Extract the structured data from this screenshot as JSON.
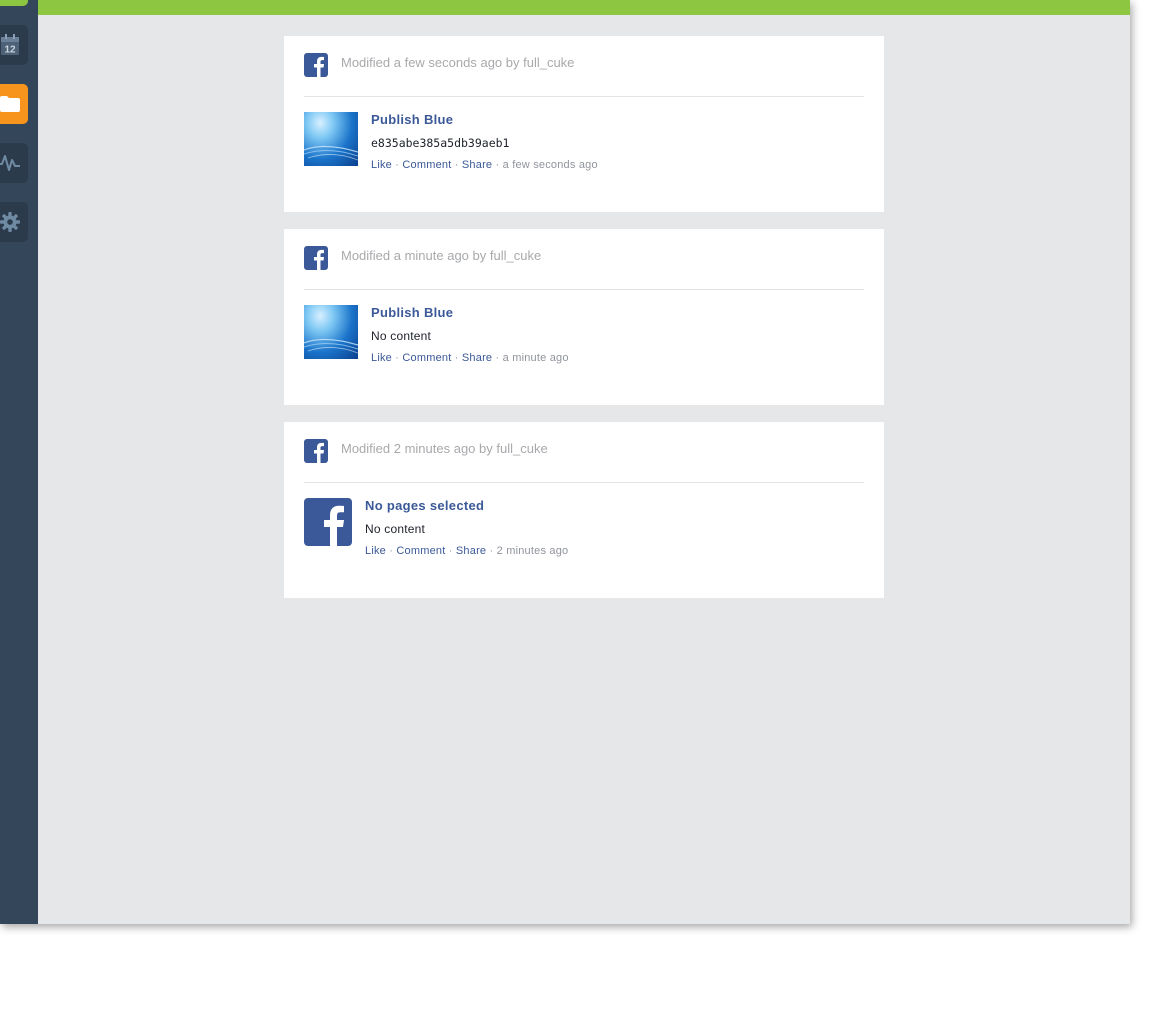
{
  "colors": {
    "sidebar": "#34475a",
    "topbar": "#8dc641",
    "facebook_blue": "#3b5998",
    "active_nav": "#f7941d"
  },
  "sidebar": {
    "items": [
      {
        "icon": "menu-icon",
        "active": false
      },
      {
        "icon": "calendar-icon",
        "label": "12"
      },
      {
        "icon": "folder-icon",
        "active": true
      },
      {
        "icon": "pulse-icon"
      },
      {
        "icon": "gear-icon"
      }
    ]
  },
  "feed": {
    "cards": [
      {
        "modified": "Modified a few seconds ago by full_cuke",
        "post": {
          "avatar": "blue-wallpaper-thumbnail",
          "title": "Publish Blue",
          "content": "e835abe385a5db39aeb1",
          "like": "Like",
          "comment": "Comment",
          "share": "Share",
          "sep": "·",
          "time": "a few seconds ago"
        }
      },
      {
        "modified": "Modified a minute ago by full_cuke",
        "post": {
          "avatar": "blue-wallpaper-thumbnail",
          "title": "Publish Blue",
          "content": "No content",
          "like": "Like",
          "comment": "Comment",
          "share": "Share",
          "sep": "·",
          "time": "a minute ago"
        }
      },
      {
        "modified": "Modified 2 minutes ago by full_cuke",
        "post": {
          "avatar": "facebook-logo",
          "title": "No pages selected",
          "content": "No content",
          "like": "Like",
          "comment": "Comment",
          "share": "Share",
          "sep": "·",
          "time": "2 minutes ago"
        }
      }
    ]
  }
}
